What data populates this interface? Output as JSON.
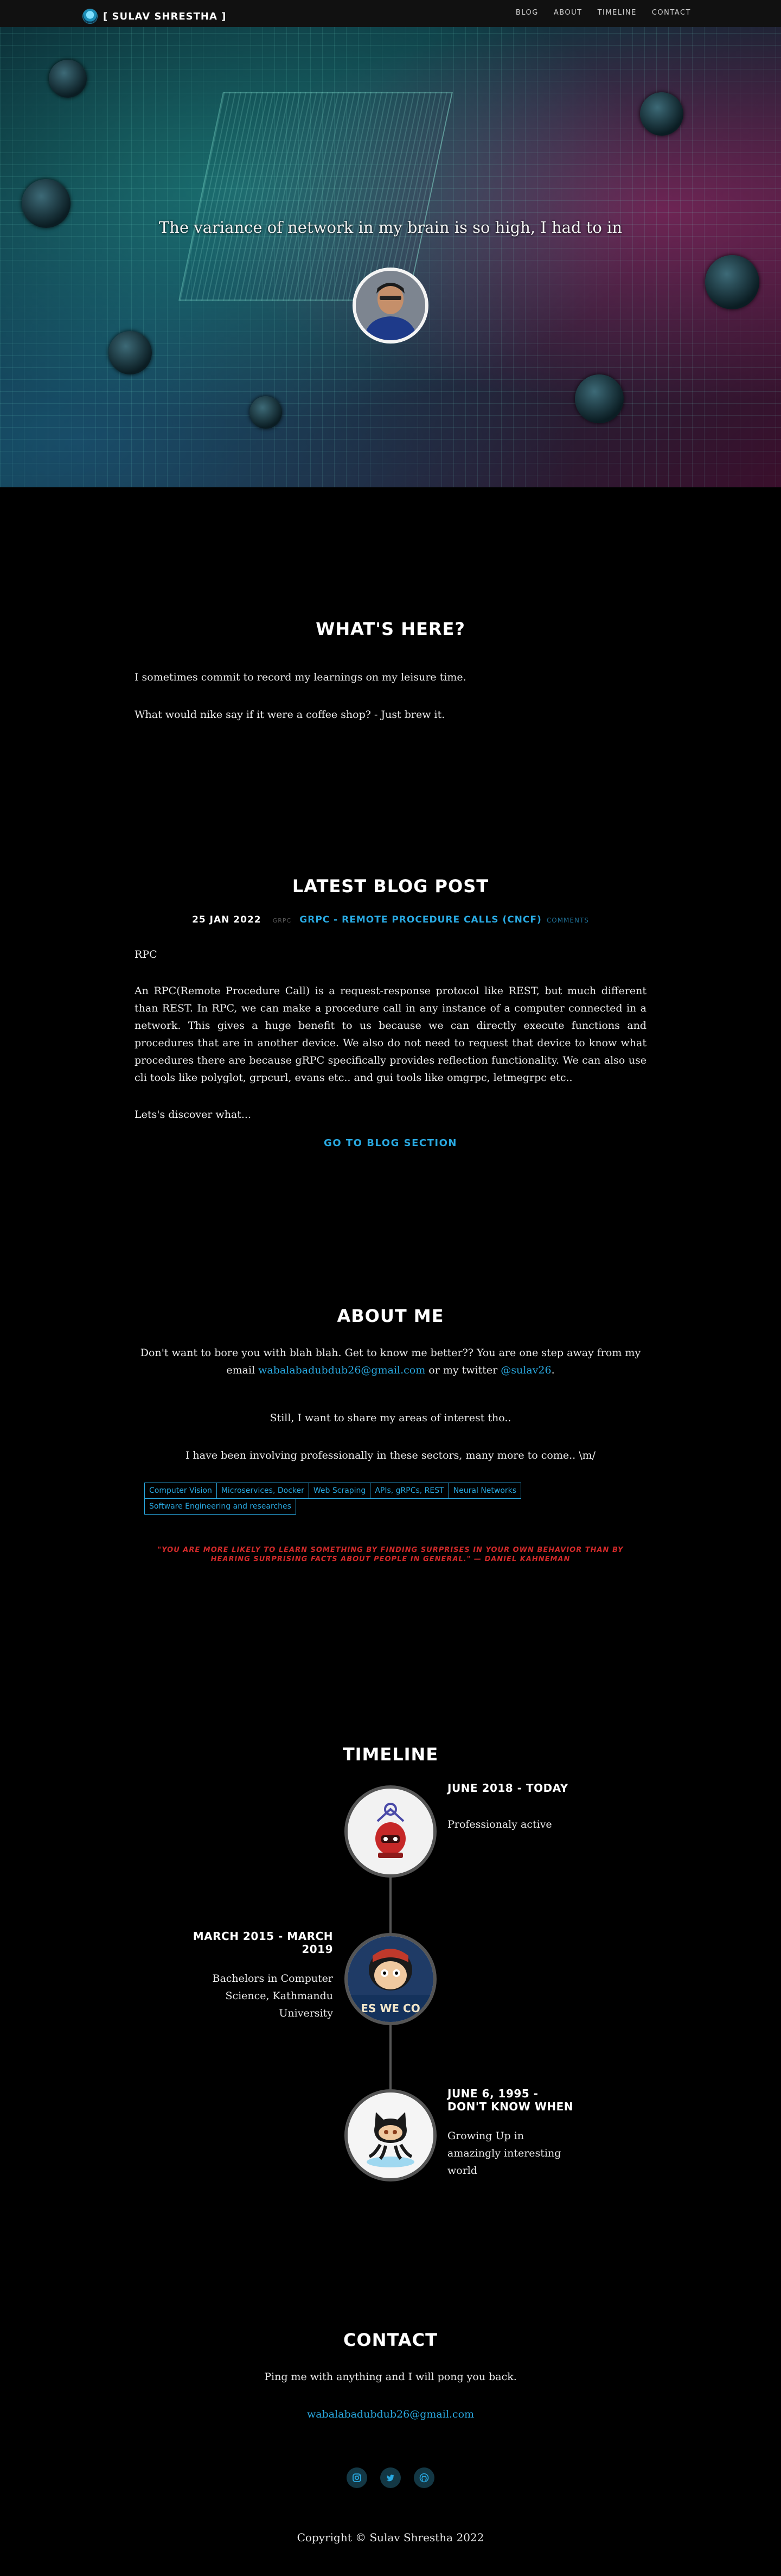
{
  "nav": {
    "brand": "[ SULAV SHRESTHA ]",
    "links": [
      "BLOG",
      "ABOUT",
      "TIMELINE",
      "CONTACT"
    ]
  },
  "hero": {
    "tagline": "The variance of network in my brain is so high, I had to in"
  },
  "whats_here": {
    "title": "WHAT'S HERE?",
    "line1": "I sometimes commit to record my learnings on my leisure time.",
    "line2": "What would nike say if it were a coffee shop? - Just brew it."
  },
  "blog": {
    "title": "LATEST BLOG POST",
    "date": "25 JAN 2022",
    "tag": "GRPC",
    "post_title": "GRPC - REMOTE PROCEDURE CALLS (CNCF)",
    "comments": "COMMENTS",
    "heading": "RPC",
    "body": "An RPC(Remote Procedure Call) is a request-response protocol like REST, but much different than REST. In RPC, we can make a procedure call in any instance of a computer connected in a network. This gives a huge benefit to us because we can directly execute functions and procedures that are in another device. We also do not need to request that device to know what procedures there are because gRPC specifically provides reflection functionality. We can also use cli tools like polyglot, grpcurl, evans etc.. and gui tools like omgrpc, letmegrpc etc..",
    "teaser": "Lets's discover what...",
    "button": "GO TO BLOG SECTION"
  },
  "about": {
    "title": "ABOUT ME",
    "intro_a": "Don't want to bore you with blah blah. Get to know me better?? You are one step away from my email",
    "email": "wabalabadubdub26@gmail.com",
    "intro_b": "or my twitter",
    "twitter": "@sulav26",
    "intro_c": ".",
    "line2": "Still, I want to share my areas of interest tho..",
    "line3": "I have been involving professionally in these sectors, many more to come.. \\m/",
    "tags": [
      "Computer Vision",
      "Microservices, Docker",
      "Web Scraping",
      "APIs, gRPCs, REST",
      "Neural Networks",
      "Software Engineering and researches"
    ],
    "quote": "\"YOU ARE MORE LIKELY TO LEARN SOMETHING BY FINDING SURPRISES IN YOUR OWN BEHAVIOR THAN BY HEARING SURPRISING FACTS ABOUT PEOPLE IN GENERAL.\" — DANIEL KAHNEMAN"
  },
  "timeline": {
    "title": "TIMELINE",
    "items": [
      {
        "date": "JUNE 2018 - TODAY",
        "desc": "Professionaly active",
        "icon": "robot-icon"
      },
      {
        "date": "MARCH 2015 - MARCH 2019",
        "desc": "Bachelors in Computer Science, Kathmandu University",
        "icon": "yes-we-code-icon",
        "image_text": "ES WE CO"
      },
      {
        "date": "JUNE 6, 1995 - DON'T KNOW WHEN",
        "desc": "Growing Up in amazingly interesting world",
        "icon": "octocat-icon"
      }
    ]
  },
  "contact": {
    "title": "CONTACT",
    "line": "Ping me with anything and I will pong you back.",
    "email": "wabalabadubdub26@gmail.com",
    "socials": [
      "instagram-icon",
      "twitter-icon",
      "github-icon"
    ],
    "copyright": "Copyright © Sulav Shrestha 2022"
  },
  "colors": {
    "accent": "#29a9e1",
    "quote": "#d22a2a",
    "background": "#000000"
  }
}
